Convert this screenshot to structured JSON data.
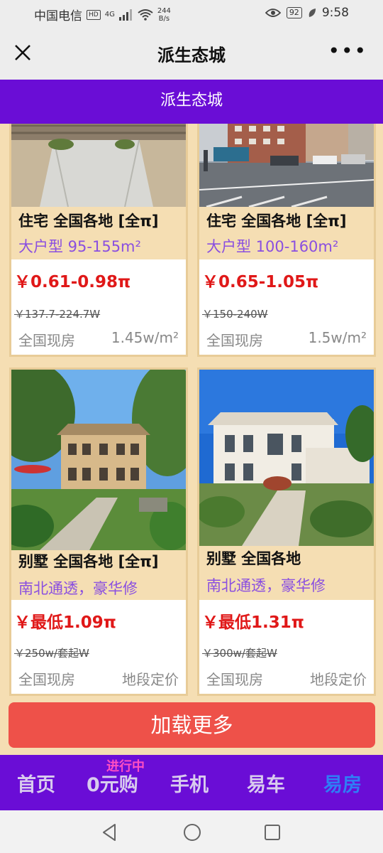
{
  "status_bar": {
    "carrier": "中国电信",
    "hd": "HD",
    "network": "4G",
    "speed_value": "244",
    "speed_unit": "B/s",
    "battery": "92",
    "time": "9:58"
  },
  "title_bar": {
    "title": "派生态城",
    "more": "•••"
  },
  "banner": {
    "title": "派生态城"
  },
  "cards": [
    {
      "type": "住宅 全国各地 [全π]",
      "desc": "大户型 95-155m²",
      "price": "￥0.61-0.98π",
      "old_price": "￥137.7-224.7W",
      "location": "全国现房",
      "unit_price": "1.45w/m²"
    },
    {
      "type": "住宅 全国各地 [全π]",
      "desc": "大户型 100-160m²",
      "price": "￥0.65-1.05π",
      "old_price": "￥150-240W",
      "location": "全国现房",
      "unit_price": "1.5w/m²"
    },
    {
      "type": "别墅 全国各地 [全π]",
      "desc": "南北通透，豪华修",
      "price": "￥最低1.09π",
      "old_price": "￥250w/套起W",
      "location": "全国现房",
      "unit_price": "地段定价"
    },
    {
      "type": "别墅 全国各地",
      "desc": "南北通透，豪华修",
      "price": "￥最低1.31π",
      "old_price": "￥300w/套起W",
      "location": "全国现房",
      "unit_price": "地段定价"
    }
  ],
  "load_more": "加载更多",
  "bottom_nav": {
    "items": [
      "首页",
      "0元购",
      "手机",
      "易车",
      "易房"
    ],
    "active": "易房",
    "badge": "进行中"
  },
  "colors": {
    "banner": "#6a0dd6",
    "price": "#e01818",
    "desc": "#8a4fe0",
    "load_more": "#ee5149",
    "active_nav": "#2f7df6",
    "card_bg": "#f5deb3"
  }
}
